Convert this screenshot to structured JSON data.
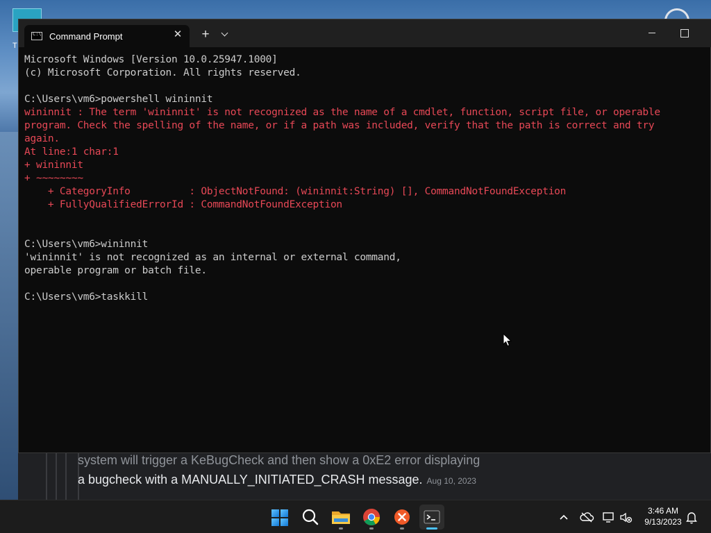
{
  "desktop": {
    "icon_label": "T",
    "article": {
      "line1": "system will trigger a KeBugCheck and then show a 0xE2 error displaying",
      "line2": "a bugcheck with a MANUALLY_INITIATED_CRASH message.",
      "date": "Aug 10, 2023"
    }
  },
  "window": {
    "tab_title": "Command Prompt",
    "tab_close": "✕",
    "new_tab": "+"
  },
  "terminal": {
    "lines": [
      {
        "text": "Microsoft Windows [Version 10.0.25947.1000]",
        "type": "normal"
      },
      {
        "text": "(c) Microsoft Corporation. All rights reserved.",
        "type": "normal"
      },
      {
        "text": "",
        "type": "normal"
      },
      {
        "text": "C:\\Users\\vm6>powershell wininnit",
        "type": "normal"
      },
      {
        "text": "wininnit : The term 'wininnit' is not recognized as the name of a cmdlet, function, script file, or operable",
        "type": "err"
      },
      {
        "text": "program. Check the spelling of the name, or if a path was included, verify that the path is correct and try",
        "type": "err"
      },
      {
        "text": "again.",
        "type": "err"
      },
      {
        "text": "At line:1 char:1",
        "type": "err"
      },
      {
        "text": "+ wininnit",
        "type": "err"
      },
      {
        "text": "+ ~~~~~~~~",
        "type": "err"
      },
      {
        "text": "    + CategoryInfo          : ObjectNotFound: (wininnit:String) [], CommandNotFoundException",
        "type": "err"
      },
      {
        "text": "    + FullyQualifiedErrorId : CommandNotFoundException",
        "type": "err"
      },
      {
        "text": "",
        "type": "normal"
      },
      {
        "text": "",
        "type": "normal"
      },
      {
        "text": "C:\\Users\\vm6>wininnit",
        "type": "normal"
      },
      {
        "text": "'wininnit' is not recognized as an internal or external command,",
        "type": "normal"
      },
      {
        "text": "operable program or batch file.",
        "type": "normal"
      },
      {
        "text": "",
        "type": "normal"
      },
      {
        "text": "C:\\Users\\vm6>taskkill",
        "type": "normal"
      }
    ]
  },
  "taskbar": {
    "time": "3:46 AM",
    "date": "9/13/2023",
    "apps": [
      {
        "name": "start-icon"
      },
      {
        "name": "search-icon"
      },
      {
        "name": "file-explorer-icon"
      },
      {
        "name": "chrome-icon"
      },
      {
        "name": "x-app-icon"
      },
      {
        "name": "terminal-icon"
      }
    ]
  },
  "colors": {
    "terminal_bg": "#0c0c0c",
    "terminal_text": "#cccccc",
    "error_text": "#e74856",
    "taskbar_bg": "#1c1c1c",
    "accent": "#4cc2ff"
  }
}
